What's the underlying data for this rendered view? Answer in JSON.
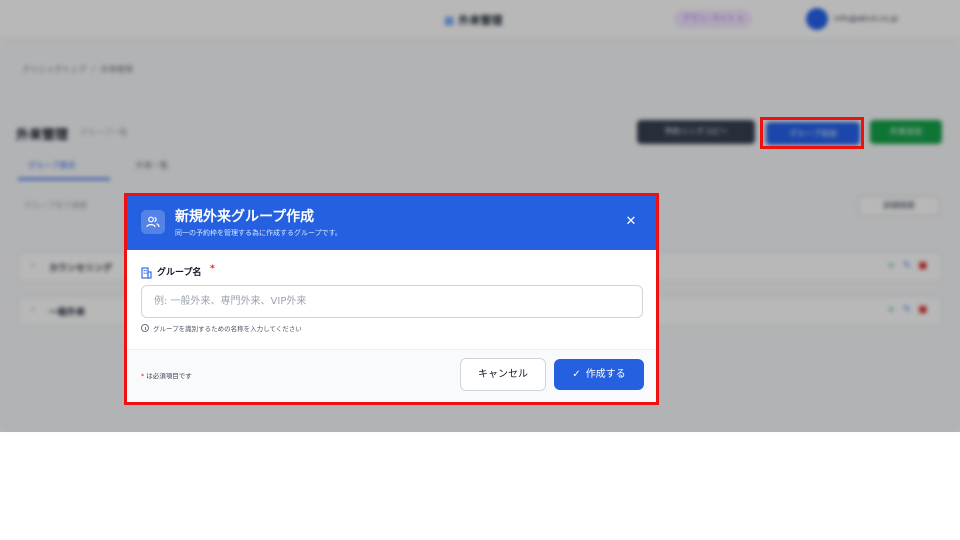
{
  "background": {
    "header_title": "外来管理",
    "plan_badge": "プラン: ライト ∨",
    "user_name": "info@abcd.co.jp",
    "breadcrumb": [
      "クリニックトップ",
      "外来管理"
    ],
    "page_title": "外来管理",
    "page_subtitle": "グループ一覧",
    "buttons": {
      "copy_link": "予約リンクコピー",
      "add_group": "グループ追加",
      "add_outpatient": "外来追加"
    },
    "tabs": [
      "グループ表示",
      "外来一覧"
    ],
    "search_placeholder": "グループ名で検索",
    "filter_button": "詳細検索",
    "group_rows": [
      {
        "label": "カウンセリング"
      },
      {
        "label": "一般外来"
      }
    ]
  },
  "modal": {
    "title": "新規外来グループ作成",
    "subtitle": "同一の予約枠を管理する為に作成するグループです。",
    "field_label": "グループ名",
    "required_mark": "*",
    "input_placeholder": "例: 一般外来、専門外来、VIP外来",
    "input_value": "",
    "help_text": "グループを識別するための名称を入力してください",
    "required_note": "は必須項目です",
    "cancel_label": "キャンセル",
    "create_label": "作成する"
  },
  "colors": {
    "primary": "#2460e0",
    "danger": "#dc2626",
    "highlight": "#ef1010",
    "success": "#16a34a"
  },
  "icons": {
    "header": "users-icon",
    "field": "building-icon",
    "help": "info-icon",
    "close": "close-icon",
    "create": "check-icon"
  }
}
